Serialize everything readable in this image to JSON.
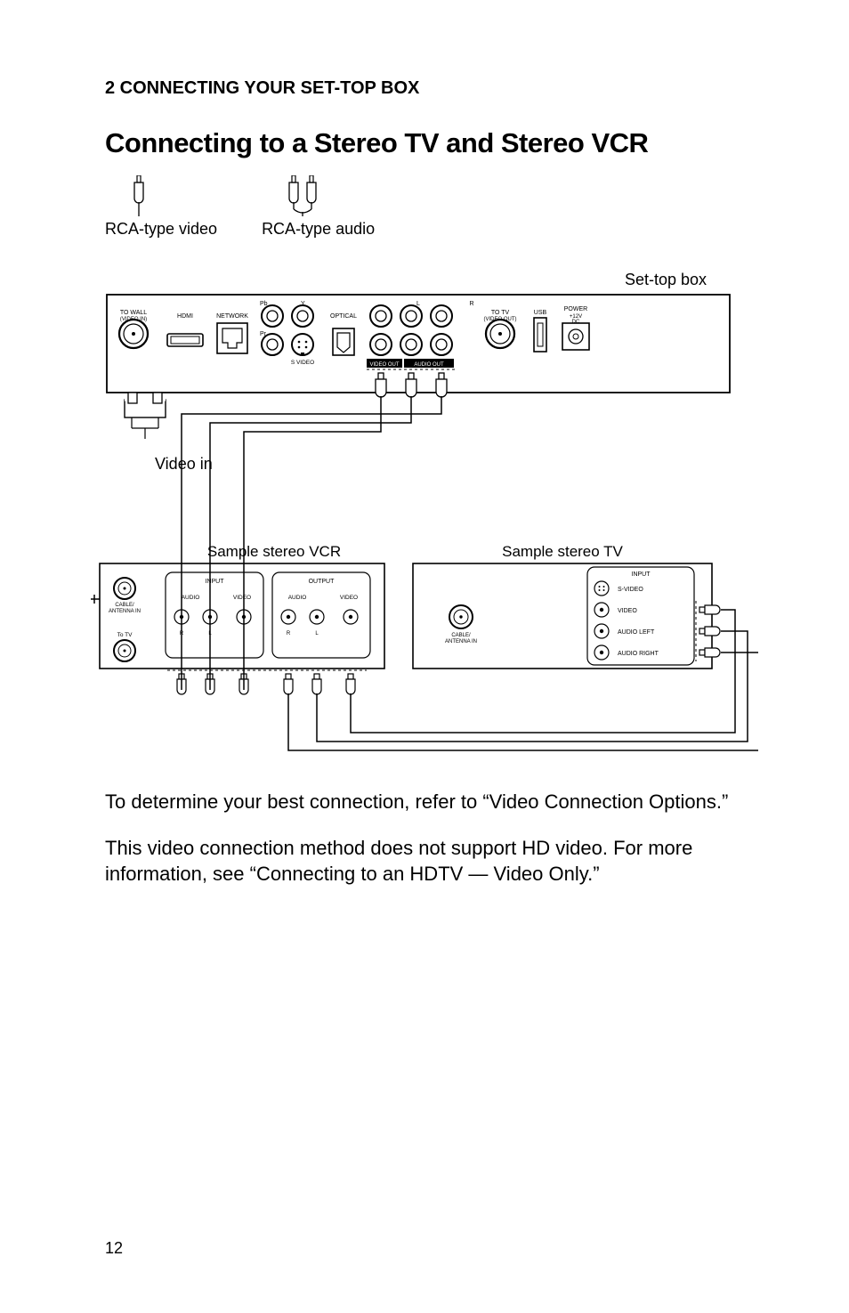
{
  "section_header": "2 CONNECTING YOUR SET-TOP BOX",
  "main_title": "Connecting to a Stereo TV and Stereo VCR",
  "cables": {
    "video": "RCA-type video",
    "audio": "RCA-type audio"
  },
  "diagram": {
    "settop_label": "Set-top box",
    "video_in_label": "Video in",
    "vcr_title": "Sample stereo VCR",
    "tv_title": "Sample stereo TV",
    "settop_ports": {
      "to_wall": "TO WALL\n(VIDEO IN)",
      "hdmi": "HDMI",
      "network": "NETWORK",
      "pb": "Pb",
      "y": "Y",
      "pr": "Pr",
      "optical": "OPTICAL",
      "l": "L",
      "r": "R",
      "svideo": "S VIDEO",
      "video_out_strip": "VIDEO OUT",
      "audio_out_strip": "AUDIO OUT",
      "to_tv": "TO TV\n(VIDEO OUT)",
      "usb": "USB",
      "power": "POWER",
      "power_sub": "+12V\nDC"
    },
    "vcr": {
      "cable_in": "CABLE/\nANTENNA IN",
      "to_tv": "To TV",
      "input": "INPUT",
      "output": "OUTPUT",
      "audio": "AUDIO",
      "video": "VIDEO",
      "r": "R",
      "l": "L"
    },
    "tv": {
      "cable_in": "CABLE/\nANTENNA IN",
      "input": "INPUT",
      "svideo": "S-VIDEO",
      "video": "VIDEO",
      "audio_left": "AUDIO LEFT",
      "audio_right": "AUDIO RIGHT"
    }
  },
  "para1": "To determine your best connection, refer to “Video Connection Options.”",
  "para2": "This video connection method does not support HD video. For more information, see “Connecting to an HDTV — Video Only.”",
  "page_number": "12"
}
